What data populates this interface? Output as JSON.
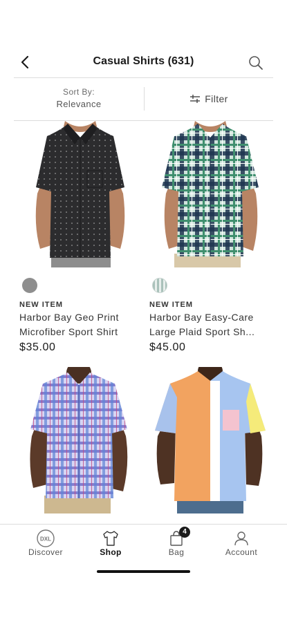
{
  "header": {
    "title": "Casual Shirts (631)"
  },
  "sort": {
    "label": "Sort By:",
    "value": "Relevance"
  },
  "filter": {
    "label": "Filter"
  },
  "products": [
    {
      "tag": "NEW ITEM",
      "name_line1": "Harbor Bay Geo Print",
      "name_line2": "Microfiber Sport Shirt",
      "price": "$35.00",
      "swatch_color": "#8e8e8e"
    },
    {
      "tag": "NEW ITEM",
      "name_line1": "Harbor Bay Easy-Care",
      "name_line2": "Large Plaid Sport Sh...",
      "price": "$45.00",
      "swatch_color": "#a9c1ba"
    },
    {
      "tag": "",
      "name_line1": "",
      "name_line2": "",
      "price": ""
    },
    {
      "tag": "",
      "name_line1": "",
      "name_line2": "",
      "price": ""
    }
  ],
  "tabbar": {
    "items": [
      {
        "label": "Discover",
        "icon": "dxl-logo-icon"
      },
      {
        "label": "Shop",
        "icon": "shirt-icon",
        "active": true
      },
      {
        "label": "Bag",
        "icon": "bag-icon",
        "badge": "4"
      },
      {
        "label": "Account",
        "icon": "user-icon"
      }
    ]
  },
  "colors": {
    "accent": "#1a1a1a",
    "divider": "#dcdcdc"
  }
}
